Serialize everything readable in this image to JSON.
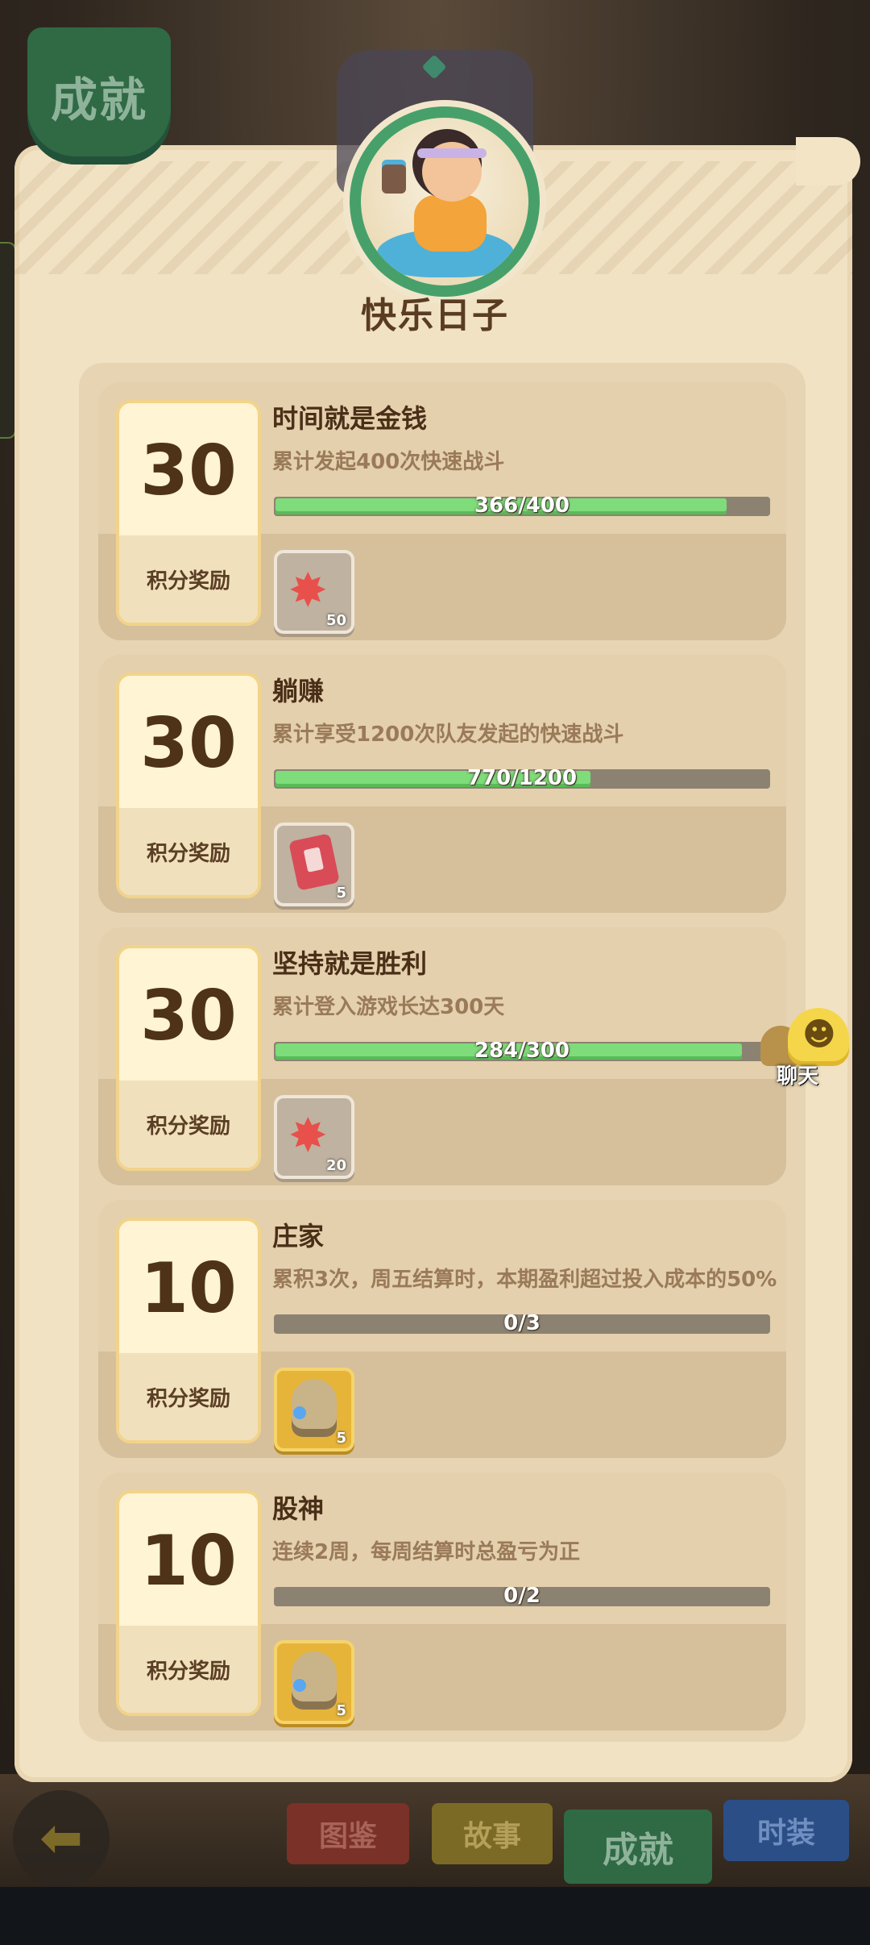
{
  "corner_tab_label": "成就",
  "page_title": "快乐日子",
  "achievements": [
    {
      "points": "30",
      "points_label": "积分奖励",
      "title": "时间就是金钱",
      "desc": "累计发起400次快速战斗",
      "progress_text": "366/400",
      "progress_fraction": 0.915,
      "reward_icon": "starfish-icon",
      "reward_count": "50"
    },
    {
      "points": "30",
      "points_label": "积分奖励",
      "title": "躺赚",
      "desc": "累计享受1200次队友发起的快速战斗",
      "progress_text": "770/1200",
      "progress_fraction": 0.642,
      "reward_icon": "ticket-icon",
      "reward_count": "5"
    },
    {
      "points": "30",
      "points_label": "积分奖励",
      "title": "坚持就是胜利",
      "desc": "累计登入游戏长达300天",
      "progress_text": "284/300",
      "progress_fraction": 0.947,
      "reward_icon": "starfish-icon",
      "reward_count": "20"
    },
    {
      "points": "10",
      "points_label": "积分奖励",
      "title": "庄家",
      "desc": "累积3次，周五结算时，本期盈利超过投入成本的50%",
      "progress_text": "0/3",
      "progress_fraction": 0,
      "reward_icon": "idol-icon",
      "reward_count": "5"
    },
    {
      "points": "10",
      "points_label": "积分奖励",
      "title": "股神",
      "desc": "连续2周，每周结算时总盈亏为正",
      "progress_text": "0/2",
      "progress_fraction": 0,
      "reward_icon": "idol-icon",
      "reward_count": "5"
    }
  ],
  "chat_label": "聊天",
  "nav": {
    "back_icon": "back-arrow-icon",
    "tab_atlas": "图鉴",
    "tab_story": "故事",
    "tab_achievements": "成就",
    "tab_fashion": "时装"
  }
}
